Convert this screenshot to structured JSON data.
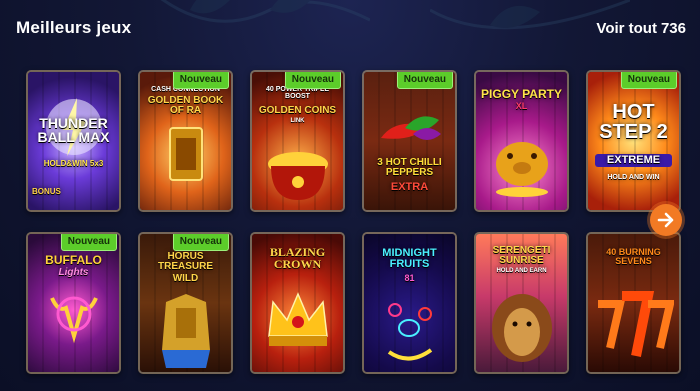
{
  "header": {
    "title": "Meilleurs jeux",
    "see_all_label": "Voir tout",
    "see_all_count": "736"
  },
  "badge_label": "Nouveau",
  "games": [
    {
      "title": "THUNDER BALL MAX",
      "subtitle": "HOLD&WIN 5x3",
      "extra": "BONUS",
      "new": false
    },
    {
      "title": "GOLDEN BOOK OF RA",
      "subtitle": "CASH CONNECTION",
      "new": true
    },
    {
      "title": "GOLDEN COINS",
      "subtitle": "40 POWER TRIPLE BOOST",
      "extra": "LINK",
      "new": true
    },
    {
      "title": "3 HOT CHILLI PEPPERS",
      "subtitle": "EXTRA",
      "new": true
    },
    {
      "title": "PIGGY PARTY",
      "subtitle": "XL",
      "new": false
    },
    {
      "title": "HOT STEP 2",
      "subtitle": "EXTREME",
      "extra": "HOLD AND WIN",
      "new": true
    },
    {
      "title": "BUFFALO",
      "subtitle": "Lights",
      "new": true
    },
    {
      "title": "HORUS TREASURE",
      "subtitle": "WILD",
      "new": true
    },
    {
      "title": "BLAZING CROWN",
      "subtitle": "",
      "new": false
    },
    {
      "title": "MIDNIGHT FRUITS",
      "subtitle": "81",
      "new": false
    },
    {
      "title": "SERENGETI SUNRISE",
      "subtitle": "HOLD AND EARN",
      "new": false
    },
    {
      "title": "40 BURNING SEVENS",
      "subtitle": "",
      "new": false
    }
  ],
  "colors": {
    "badge": "#5ccd2a",
    "arrow": "#f27a24",
    "background": "#121735"
  },
  "icons": {
    "next": "arrow-right-icon"
  }
}
